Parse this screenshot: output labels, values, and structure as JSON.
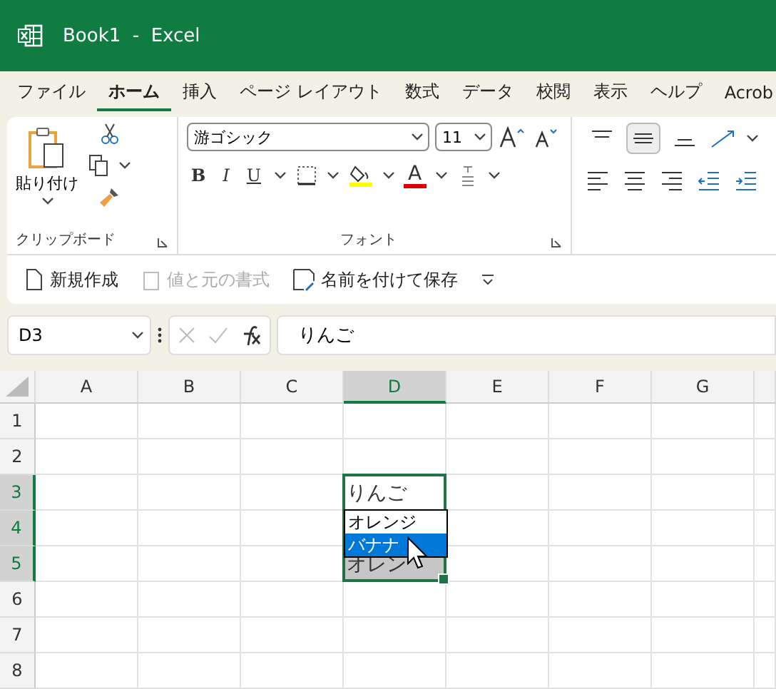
{
  "window": {
    "title": "Book1  -  Excel"
  },
  "tabs": [
    {
      "label": "ファイル",
      "selected": false
    },
    {
      "label": "ホーム",
      "selected": true
    },
    {
      "label": "挿入",
      "selected": false
    },
    {
      "label": "ページ レイアウト",
      "selected": false
    },
    {
      "label": "数式",
      "selected": false
    },
    {
      "label": "データ",
      "selected": false
    },
    {
      "label": "校閲",
      "selected": false
    },
    {
      "label": "表示",
      "selected": false
    },
    {
      "label": "ヘルプ",
      "selected": false
    },
    {
      "label": "Acrob",
      "selected": false
    }
  ],
  "ribbon": {
    "clipboard": {
      "paste_label": "貼り付け",
      "group_label": "クリップボード"
    },
    "font": {
      "font_name": "游ゴシック",
      "font_size": "11",
      "bold_key": "B",
      "italic_key": "I",
      "underline_key": "U",
      "font_color_key": "A",
      "group_label": "フォント"
    }
  },
  "quick_actions": [
    {
      "label": "新規作成",
      "disabled": false
    },
    {
      "label": "値と元の書式",
      "disabled": true
    },
    {
      "label": "名前を付けて保存",
      "disabled": false
    }
  ],
  "formula_bar": {
    "name_box": "D3",
    "formula": "りんご"
  },
  "sheet": {
    "columns": [
      {
        "label": "A",
        "selected": false
      },
      {
        "label": "B",
        "selected": false
      },
      {
        "label": "C",
        "selected": false
      },
      {
        "label": "D",
        "selected": true
      },
      {
        "label": "E",
        "selected": false
      },
      {
        "label": "F",
        "selected": false
      },
      {
        "label": "G",
        "selected": false
      }
    ],
    "rows": [
      {
        "label": "1",
        "selected": false
      },
      {
        "label": "2",
        "selected": false
      },
      {
        "label": "3",
        "selected": true,
        "cells": {
          "D": {
            "value": "りんご",
            "active": true
          }
        }
      },
      {
        "label": "4",
        "selected": true
      },
      {
        "label": "5",
        "selected": true,
        "cells": {
          "D": {
            "value": "オレン",
            "active": false
          }
        }
      },
      {
        "label": "6",
        "selected": false
      },
      {
        "label": "7",
        "selected": false
      },
      {
        "label": "8",
        "selected": false
      }
    ],
    "dropdown": {
      "items": [
        {
          "label": "オレンジ",
          "selected": false
        },
        {
          "label": "バナナ",
          "selected": true
        }
      ]
    }
  }
}
